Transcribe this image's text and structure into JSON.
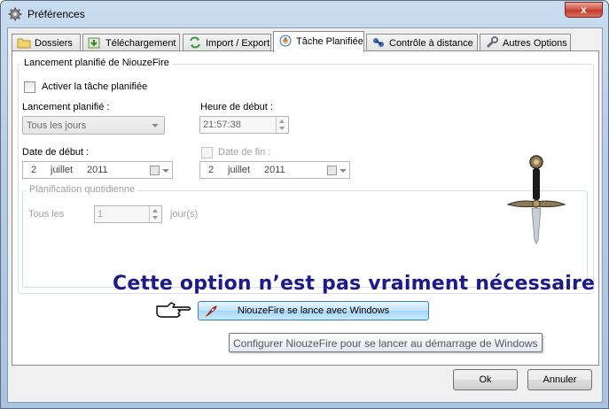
{
  "window": {
    "title": "Préférences",
    "close_label": "x"
  },
  "tabs": [
    {
      "label": "Dossiers",
      "icon": "folder-icon"
    },
    {
      "label": "Téléchargement",
      "icon": "download-icon"
    },
    {
      "label": "Import / Export",
      "icon": "import-export-icon"
    },
    {
      "label": "Tâche Planifiée",
      "icon": "scheduled-task-icon",
      "active": true
    },
    {
      "label": "Contrôle à distance",
      "icon": "remote-control-icon"
    },
    {
      "label": "Autres Options",
      "icon": "wrench-icon"
    }
  ],
  "scheduler": {
    "group_title": "Lancement planifié de NiouzeFire",
    "activate_label": "Activer la tâche planifiée",
    "activate_checked": false,
    "launch_label": "Lancement planifié :",
    "launch_value": "Tous les jours",
    "start_time_label": "Heure de début :",
    "start_time_value": "21:57:38",
    "start_date_label": "Date de début :",
    "start_date": {
      "day": "2",
      "month": "juillet",
      "year": "2011"
    },
    "end_date_label": "Date de fin :",
    "end_date_checked": false,
    "end_date": {
      "day": "2",
      "month": "juillet",
      "year": "2011"
    },
    "daily_group_title": "Planification quotidienne",
    "every_label": "Tous les",
    "every_value": "1",
    "every_unit": "jour(s)"
  },
  "annotation": "Cette option n’est pas vraiment nécessaire",
  "launch_windows_button": "NiouzeFire se lance avec Windows",
  "tooltip": "Configurer NiouzeFire pour se lancer au démarrage de Windows",
  "footer": {
    "ok_label": "Ok",
    "cancel_label": "Annuler"
  },
  "colors": {
    "annotation": "#1d1a8a",
    "accent_button": "#bfe2fb",
    "close_button": "#c23b2e"
  }
}
